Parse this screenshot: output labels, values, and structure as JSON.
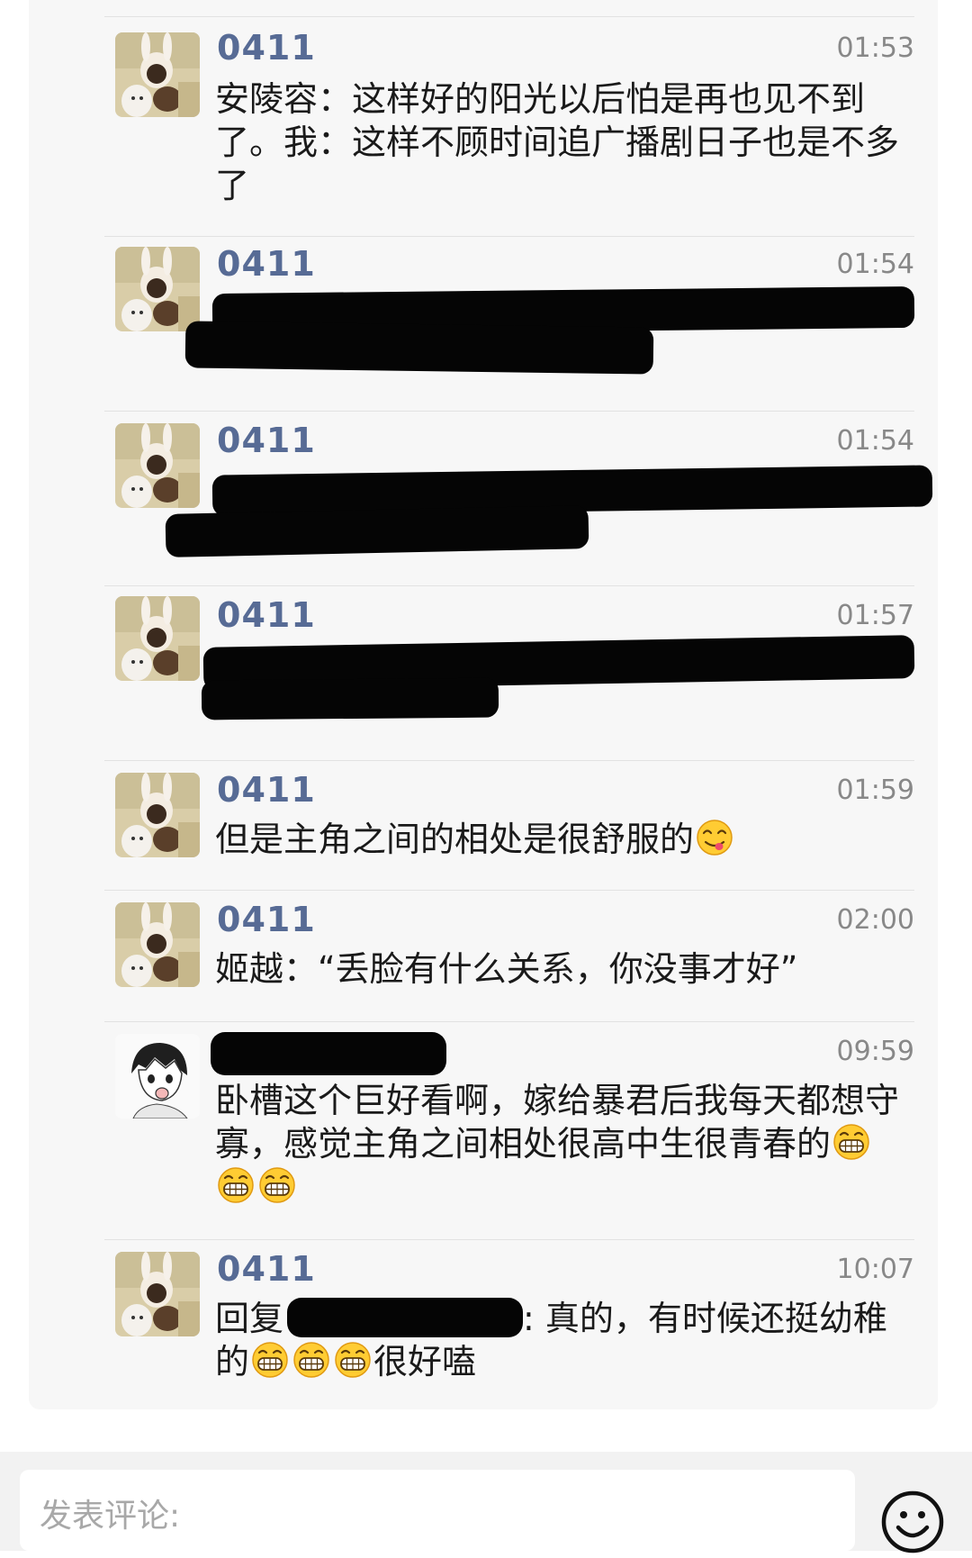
{
  "comments": [
    {
      "author": "0411",
      "time": "01:53",
      "text": "安陵容：这样好的阳光以后怕是再也见不到了。我：这样不顾时间追广播剧日子也是不多了"
    },
    {
      "author": "0411",
      "time": "01:54"
    },
    {
      "author": "0411",
      "time": "01:54"
    },
    {
      "author": "0411",
      "time": "01:57"
    },
    {
      "author": "0411",
      "time": "01:59",
      "text": "但是主角之间的相处是很舒服的"
    },
    {
      "author": "0411",
      "time": "02:00",
      "text": "姬越：“丢脸有什么关系，你没事才好”"
    },
    {
      "time": "09:59",
      "text": "卧槽这个巨好看啊，嫁给暴君后我每天都想守寡，感觉主角之间相处很高中生很青春的"
    },
    {
      "author": "0411",
      "time": "10:07",
      "reply_prefix": "回复",
      "reply_text": ": 真的，有时候还挺幼稚",
      "text_after_line_break": "的",
      "text_end": "很好嗑"
    }
  ],
  "input": {
    "placeholder": "发表评论:"
  },
  "icons": {
    "emoji_button": "smiley-face-icon",
    "emoji_inline": "grinning-face-icon",
    "emoji_yum": "yum-face-icon"
  },
  "colors": {
    "author": "#576b95",
    "time": "#888888",
    "panel": "#f7f7f7"
  }
}
